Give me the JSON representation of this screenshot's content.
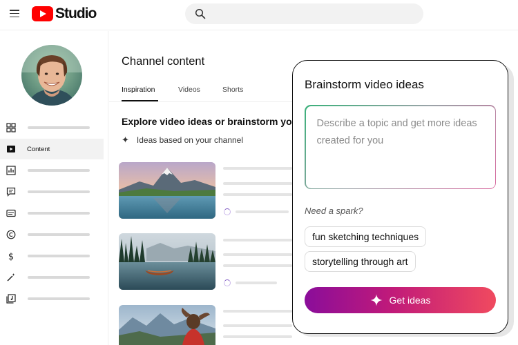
{
  "header": {
    "logo_text": "Studio"
  },
  "sidebar": {
    "items": [
      {
        "icon": "dashboard-icon",
        "label": ""
      },
      {
        "icon": "content-icon",
        "label": "Content"
      },
      {
        "icon": "analytics-icon",
        "label": ""
      },
      {
        "icon": "comments-icon",
        "label": ""
      },
      {
        "icon": "subtitles-icon",
        "label": ""
      },
      {
        "icon": "copyright-icon",
        "label": ""
      },
      {
        "icon": "earn-icon",
        "label": ""
      },
      {
        "icon": "customization-icon",
        "label": ""
      },
      {
        "icon": "audio-library-icon",
        "label": ""
      }
    ]
  },
  "main": {
    "title": "Channel content",
    "tabs": [
      {
        "label": "Inspiration",
        "active": true
      },
      {
        "label": "Videos",
        "active": false
      },
      {
        "label": "Shorts",
        "active": false
      }
    ],
    "explore_heading": "Explore video ideas or brainstorm you",
    "ideas_label": "Ideas based on your channel"
  },
  "brainstorm": {
    "title": "Brainstorm video ideas",
    "placeholder": "Describe a topic and get more ideas created for you",
    "spark_label": "Need a spark?",
    "chips": [
      "fun sketching techniques",
      "storytelling through art"
    ],
    "button_label": "Get ideas"
  },
  "colors": {
    "brand_red": "#ff0000",
    "cta_gradient_start": "#8a0d9a",
    "cta_gradient_end": "#f04a5f"
  }
}
